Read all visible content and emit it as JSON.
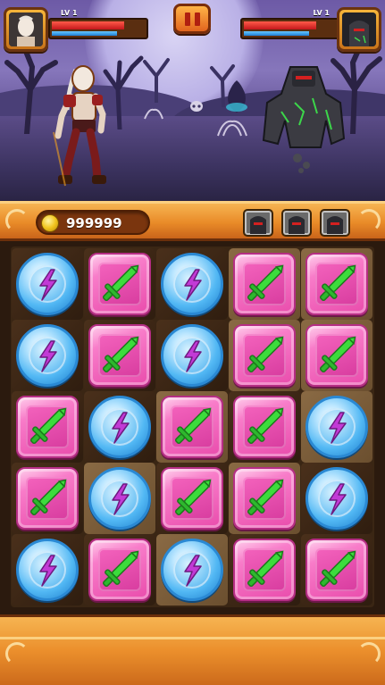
{
  "player": {
    "level": "LV 1",
    "hp_fraction": 0.78,
    "mp_fraction": 0.7
  },
  "enemy": {
    "level": "LV 1",
    "hp_fraction": 0.78,
    "mp_fraction": 0.7
  },
  "coins": "999999",
  "enemy_queue": [
    "golem-enemy-icon",
    "golem-enemy-icon",
    "golem-enemy-icon"
  ],
  "colors": {
    "hp": "#e0262b",
    "mp": "#2f9be8",
    "frame_orange": "#eb8f2c",
    "pink_tile": "#f463bd",
    "blue_orb": "#52b8f4",
    "sword_green": "#3cdc3c",
    "bolt_purple": "#c23ad6"
  },
  "board": {
    "rows": [
      [
        "blue",
        "pink",
        "blue",
        "pink",
        "pink"
      ],
      [
        "blue",
        "pink",
        "blue",
        "pink",
        "pink"
      ],
      [
        "pink",
        "blue",
        "pink",
        "pink",
        "blue"
      ],
      [
        "pink",
        "blue",
        "pink",
        "pink",
        "blue"
      ],
      [
        "blue",
        "pink",
        "blue",
        "pink",
        "pink"
      ]
    ],
    "cell_shades": [
      [
        "dark",
        "dark",
        "dark",
        "light",
        "light"
      ],
      [
        "dark",
        "dark",
        "dark",
        "light",
        "light"
      ],
      [
        "dark",
        "dark",
        "light",
        "dark",
        "light"
      ],
      [
        "dark",
        "light",
        "dark",
        "light",
        "dark"
      ],
      [
        "dark",
        "dark",
        "light",
        "dark",
        "dark"
      ]
    ]
  }
}
